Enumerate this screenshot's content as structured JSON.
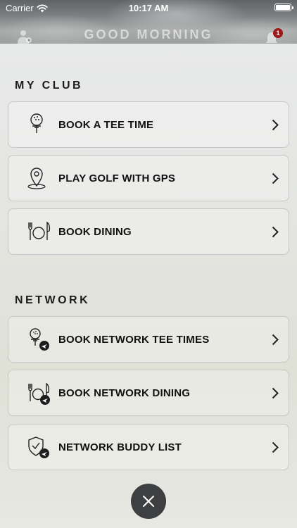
{
  "status_bar": {
    "carrier": "Carrier",
    "time": "10:17 AM"
  },
  "header": {
    "greeting": "GOOD MORNING",
    "notification_count": "1"
  },
  "sections": {
    "my_club": {
      "title": "MY CLUB",
      "items": [
        {
          "label": "BOOK A TEE TIME",
          "icon": "golf-ball-tee-icon"
        },
        {
          "label": "PLAY GOLF WITH GPS",
          "icon": "map-pin-icon"
        },
        {
          "label": "BOOK DINING",
          "icon": "dining-icon"
        }
      ]
    },
    "network": {
      "title": "NETWORK",
      "items": [
        {
          "label": "BOOK NETWORK TEE TIMES",
          "icon": "golf-ball-tee-plane-icon"
        },
        {
          "label": "BOOK NETWORK DINING",
          "icon": "dining-plane-icon"
        },
        {
          "label": "NETWORK BUDDY LIST",
          "icon": "shield-check-plane-icon"
        }
      ]
    }
  },
  "colors": {
    "badge": "#9b1b1b",
    "close_button": "#3d3f41",
    "text": "#111111"
  }
}
